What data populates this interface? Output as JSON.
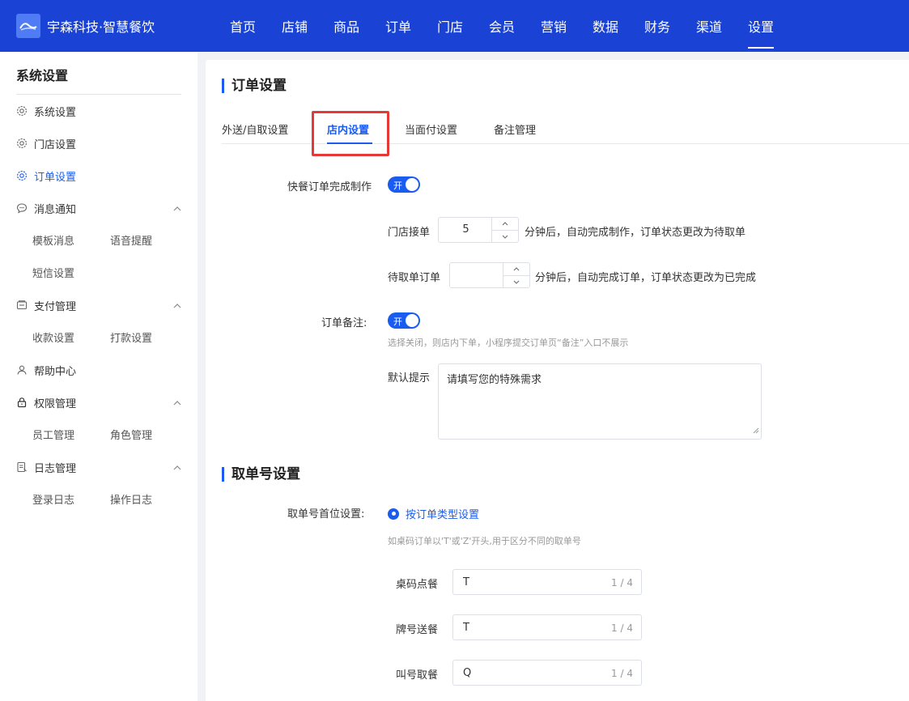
{
  "brand": {
    "name": "宇森科技·智慧餐饮"
  },
  "nav": [
    "首页",
    "店铺",
    "商品",
    "订单",
    "门店",
    "会员",
    "营销",
    "数据",
    "财务",
    "渠道",
    "设置"
  ],
  "sidebar": {
    "title": "系统设置",
    "items": [
      {
        "label": "系统设置",
        "icon": "gear-icon"
      },
      {
        "label": "门店设置",
        "icon": "gear-icon"
      },
      {
        "label": "订单设置",
        "icon": "gear-icon",
        "active": true
      },
      {
        "label": "消息通知",
        "icon": "chat-icon",
        "subs": [
          "模板消息",
          "语音提醒",
          "短信设置"
        ]
      },
      {
        "label": "支付管理",
        "icon": "wallet-icon",
        "subs": [
          "收款设置",
          "打款设置"
        ]
      },
      {
        "label": "帮助中心",
        "icon": "user-icon"
      },
      {
        "label": "权限管理",
        "icon": "lock-icon",
        "subs": [
          "员工管理",
          "角色管理"
        ]
      },
      {
        "label": "日志管理",
        "icon": "log-icon",
        "subs": [
          "登录日志",
          "操作日志"
        ]
      }
    ]
  },
  "main": {
    "title": "订单设置",
    "tabs": [
      "外送/自取设置",
      "店内设置",
      "当面付设置",
      "备注管理"
    ],
    "active_tab": "店内设置",
    "fast_order": {
      "label": "快餐订单完成制作",
      "switch_text": "开",
      "store_accept_label": "门店接单",
      "store_accept_value": "5",
      "store_accept_suffix": "分钟后，自动完成制作，订单状态更改为待取单",
      "pending_label": "待取单订单",
      "pending_value": "",
      "pending_suffix": "分钟后，自动完成订单，订单状态更改为已完成"
    },
    "remark": {
      "label": "订单备注:",
      "switch_text": "开",
      "hint": "选择关闭，则店内下单，小程序提交订单页“备注”入口不展示",
      "default_label": "默认提示",
      "default_value": "请填写您的特殊需求"
    },
    "pickup": {
      "title": "取单号设置",
      "first_label": "取单号首位设置:",
      "radio_label": "按订单类型设置",
      "hint": "如桌码订单以'T'或'Z'开头,用于区分不同的取单号",
      "rows": [
        {
          "label": "桌码点餐",
          "value": "T",
          "count": "1 / 4"
        },
        {
          "label": "牌号送餐",
          "value": "T",
          "count": "1 / 4"
        },
        {
          "label": "叫号取餐",
          "value": "Q",
          "count": "1 / 4"
        }
      ]
    }
  },
  "colors": {
    "nav_bg": "#1a43d6",
    "accent": "#1a5cf0",
    "highlight": "#e53935"
  }
}
